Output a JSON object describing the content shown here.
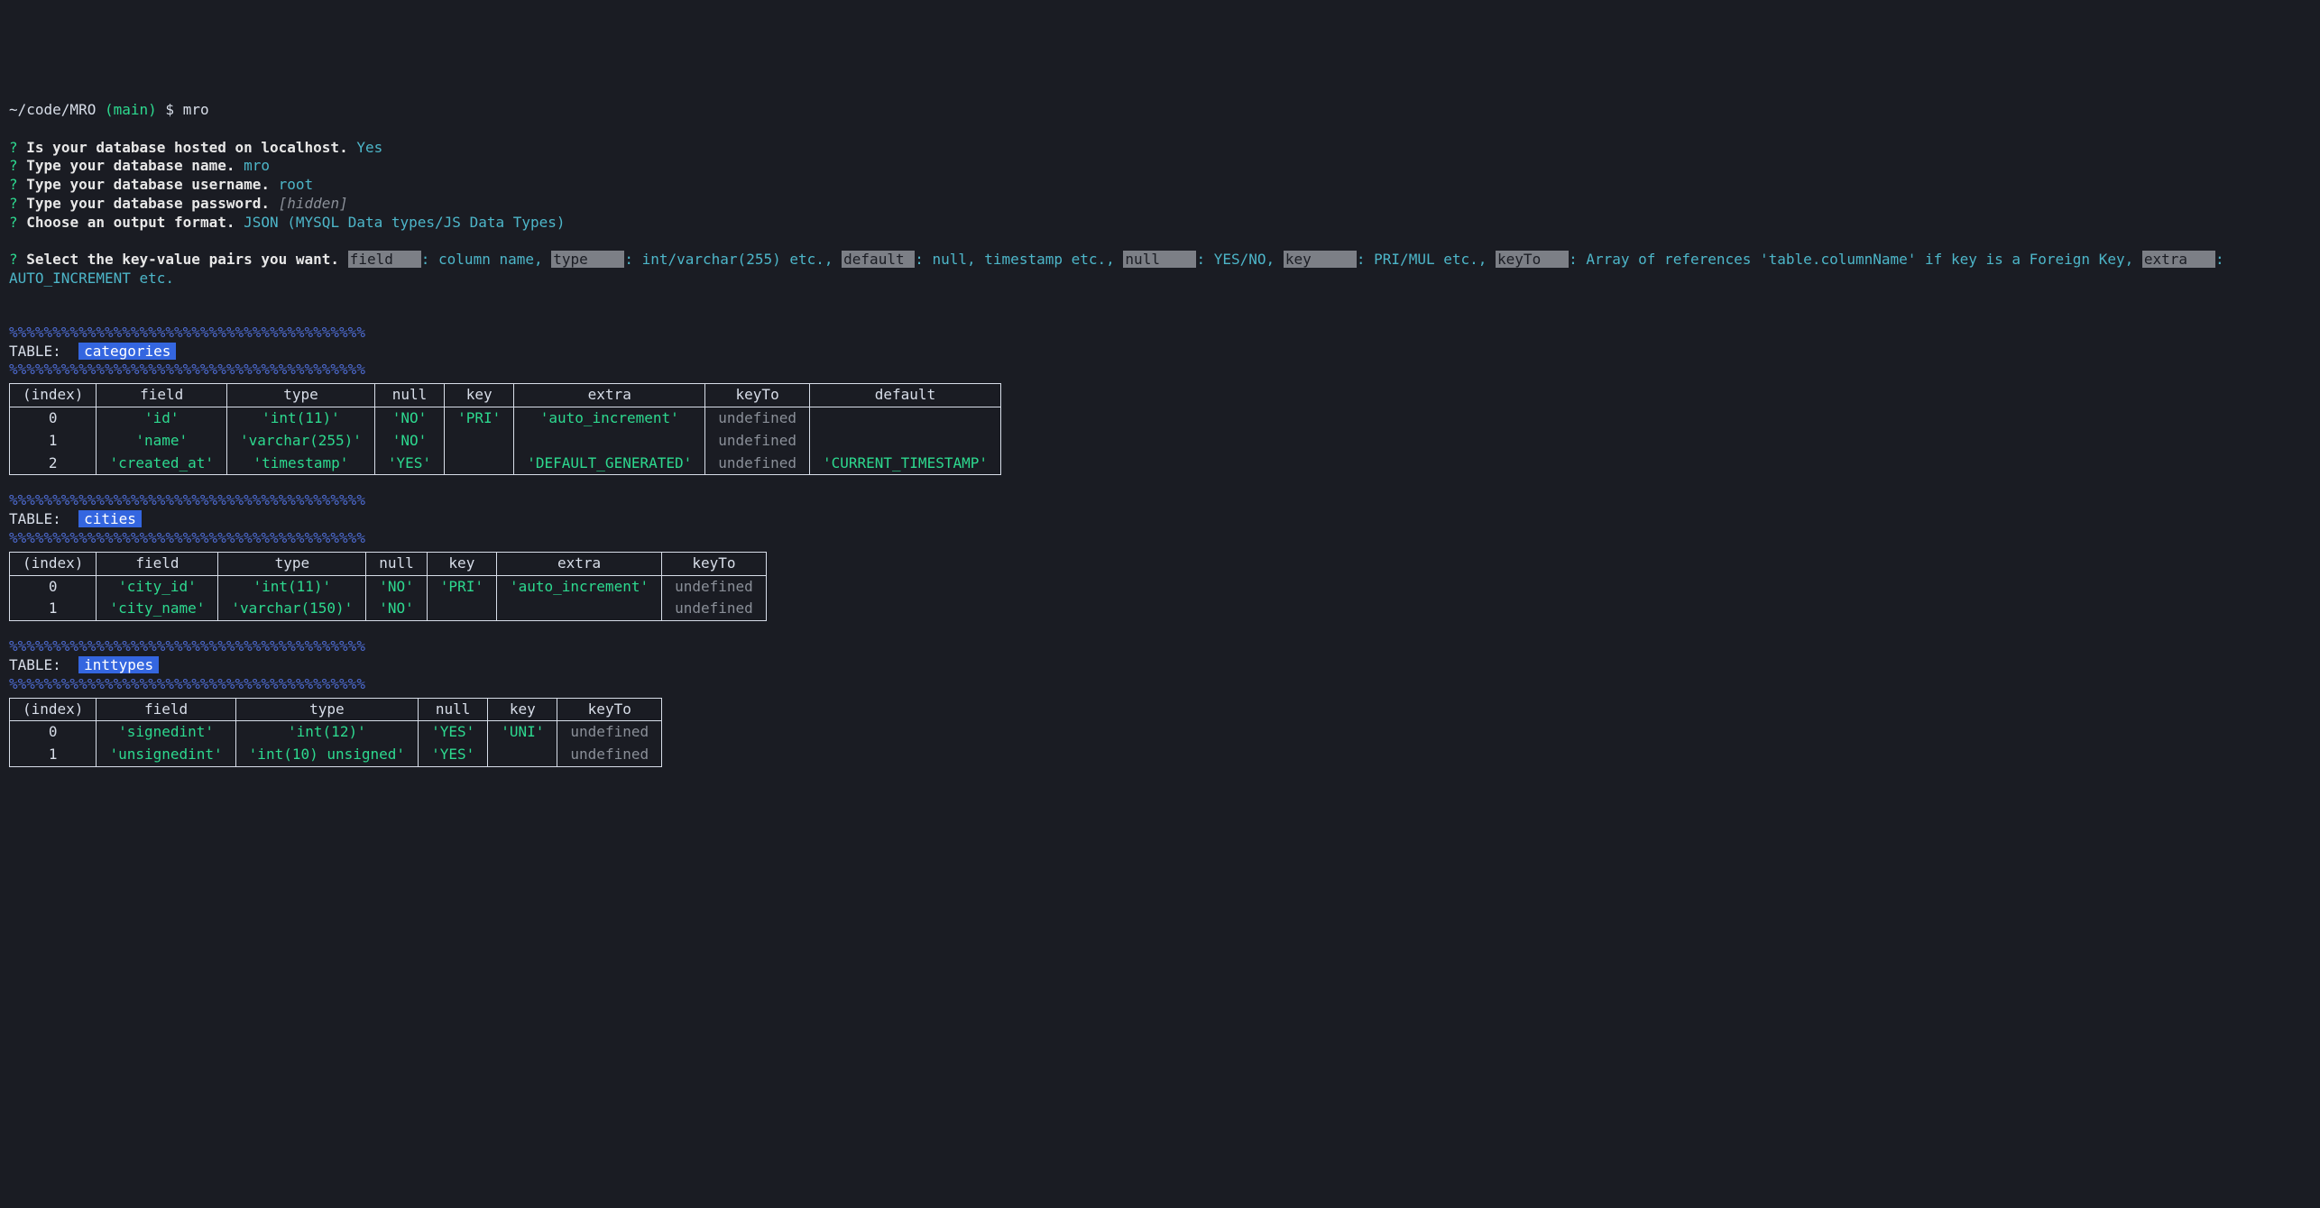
{
  "shell": {
    "path": "~/code/MRO",
    "branch": "(main)",
    "dollar": "$",
    "command": "mro"
  },
  "prompts": [
    {
      "q": "?",
      "label": "Is your database hosted on localhost.",
      "answer": "Yes",
      "answer_class": "ans-cyan"
    },
    {
      "q": "?",
      "label": "Type your database name.",
      "answer": "mro",
      "answer_class": "ans-cyan"
    },
    {
      "q": "?",
      "label": "Type your database username.",
      "answer": "root",
      "answer_class": "ans-cyan"
    },
    {
      "q": "?",
      "label": "Type your database password.",
      "answer": "[hidden]",
      "answer_class": "ans-dim"
    },
    {
      "q": "?",
      "label": "Choose an output format.",
      "answer": "JSON (MYSQL Data types/JS Data Types)",
      "answer_class": "ans-cyan"
    }
  ],
  "kv_prompt": {
    "q": "?",
    "label": "Select the key-value pairs you want.",
    "pairs": [
      {
        "key": "field   ",
        "desc": ": column name,"
      },
      {
        "key": "type    ",
        "desc": ": int/varchar(255) etc.,"
      },
      {
        "key": "default ",
        "desc": ": null, timestamp etc.,"
      },
      {
        "key": "null    ",
        "desc": ": YES/NO,"
      },
      {
        "key": "key     ",
        "desc": ": PRI/MUL etc.,"
      },
      {
        "key": "keyTo   ",
        "desc": ": Array of references 'table.columnName' if key is a Foreign Key,"
      },
      {
        "key": "extra   ",
        "desc": ": AUTO_INCREMENT etc."
      }
    ]
  },
  "decor_line": "%%%%%%%%%%%%%%%%%%%%%%%%%%%%%%%%%%%%%%%%%",
  "label_table": "TABLE:  ",
  "tables": [
    {
      "name": "categories",
      "columns": [
        "(index)",
        "field",
        "type",
        "null",
        "key",
        "extra",
        "keyTo",
        "default"
      ],
      "rows": [
        {
          "cells": [
            {
              "t": "0",
              "c": "v-idx"
            },
            {
              "t": "'id'",
              "c": "v-str"
            },
            {
              "t": "'int(11)'",
              "c": "v-str"
            },
            {
              "t": "'NO'",
              "c": "v-str"
            },
            {
              "t": "'PRI'",
              "c": "v-str"
            },
            {
              "t": "'auto_increment'",
              "c": "v-str"
            },
            {
              "t": "undefined",
              "c": "v-undef"
            },
            {
              "t": "",
              "c": "v-idx"
            }
          ]
        },
        {
          "cells": [
            {
              "t": "1",
              "c": "v-idx"
            },
            {
              "t": "'name'",
              "c": "v-str"
            },
            {
              "t": "'varchar(255)'",
              "c": "v-str"
            },
            {
              "t": "'NO'",
              "c": "v-str"
            },
            {
              "t": "",
              "c": "v-idx"
            },
            {
              "t": "",
              "c": "v-idx"
            },
            {
              "t": "undefined",
              "c": "v-undef"
            },
            {
              "t": "",
              "c": "v-idx"
            }
          ]
        },
        {
          "cells": [
            {
              "t": "2",
              "c": "v-idx"
            },
            {
              "t": "'created_at'",
              "c": "v-str"
            },
            {
              "t": "'timestamp'",
              "c": "v-str"
            },
            {
              "t": "'YES'",
              "c": "v-str"
            },
            {
              "t": "",
              "c": "v-idx"
            },
            {
              "t": "'DEFAULT_GENERATED'",
              "c": "v-str"
            },
            {
              "t": "undefined",
              "c": "v-undef"
            },
            {
              "t": "'CURRENT_TIMESTAMP'",
              "c": "v-str"
            }
          ]
        }
      ]
    },
    {
      "name": "cities",
      "columns": [
        "(index)",
        "field",
        "type",
        "null",
        "key",
        "extra",
        "keyTo"
      ],
      "rows": [
        {
          "cells": [
            {
              "t": "0",
              "c": "v-idx"
            },
            {
              "t": "'city_id'",
              "c": "v-str"
            },
            {
              "t": "'int(11)'",
              "c": "v-str"
            },
            {
              "t": "'NO'",
              "c": "v-str"
            },
            {
              "t": "'PRI'",
              "c": "v-str"
            },
            {
              "t": "'auto_increment'",
              "c": "v-str"
            },
            {
              "t": "undefined",
              "c": "v-undef"
            }
          ]
        },
        {
          "cells": [
            {
              "t": "1",
              "c": "v-idx"
            },
            {
              "t": "'city_name'",
              "c": "v-str"
            },
            {
              "t": "'varchar(150)'",
              "c": "v-str"
            },
            {
              "t": "'NO'",
              "c": "v-str"
            },
            {
              "t": "",
              "c": "v-idx"
            },
            {
              "t": "",
              "c": "v-idx"
            },
            {
              "t": "undefined",
              "c": "v-undef"
            }
          ]
        }
      ]
    },
    {
      "name": "inttypes",
      "columns": [
        "(index)",
        "field",
        "type",
        "null",
        "key",
        "keyTo"
      ],
      "rows": [
        {
          "cells": [
            {
              "t": "0",
              "c": "v-idx"
            },
            {
              "t": "'signedint'",
              "c": "v-str"
            },
            {
              "t": "'int(12)'",
              "c": "v-str"
            },
            {
              "t": "'YES'",
              "c": "v-str"
            },
            {
              "t": "'UNI'",
              "c": "v-str"
            },
            {
              "t": "undefined",
              "c": "v-undef"
            }
          ]
        },
        {
          "cells": [
            {
              "t": "1",
              "c": "v-idx"
            },
            {
              "t": "'unsignedint'",
              "c": "v-str"
            },
            {
              "t": "'int(10) unsigned'",
              "c": "v-str"
            },
            {
              "t": "'YES'",
              "c": "v-str"
            },
            {
              "t": "",
              "c": "v-idx"
            },
            {
              "t": "undefined",
              "c": "v-undef"
            }
          ]
        }
      ]
    }
  ]
}
